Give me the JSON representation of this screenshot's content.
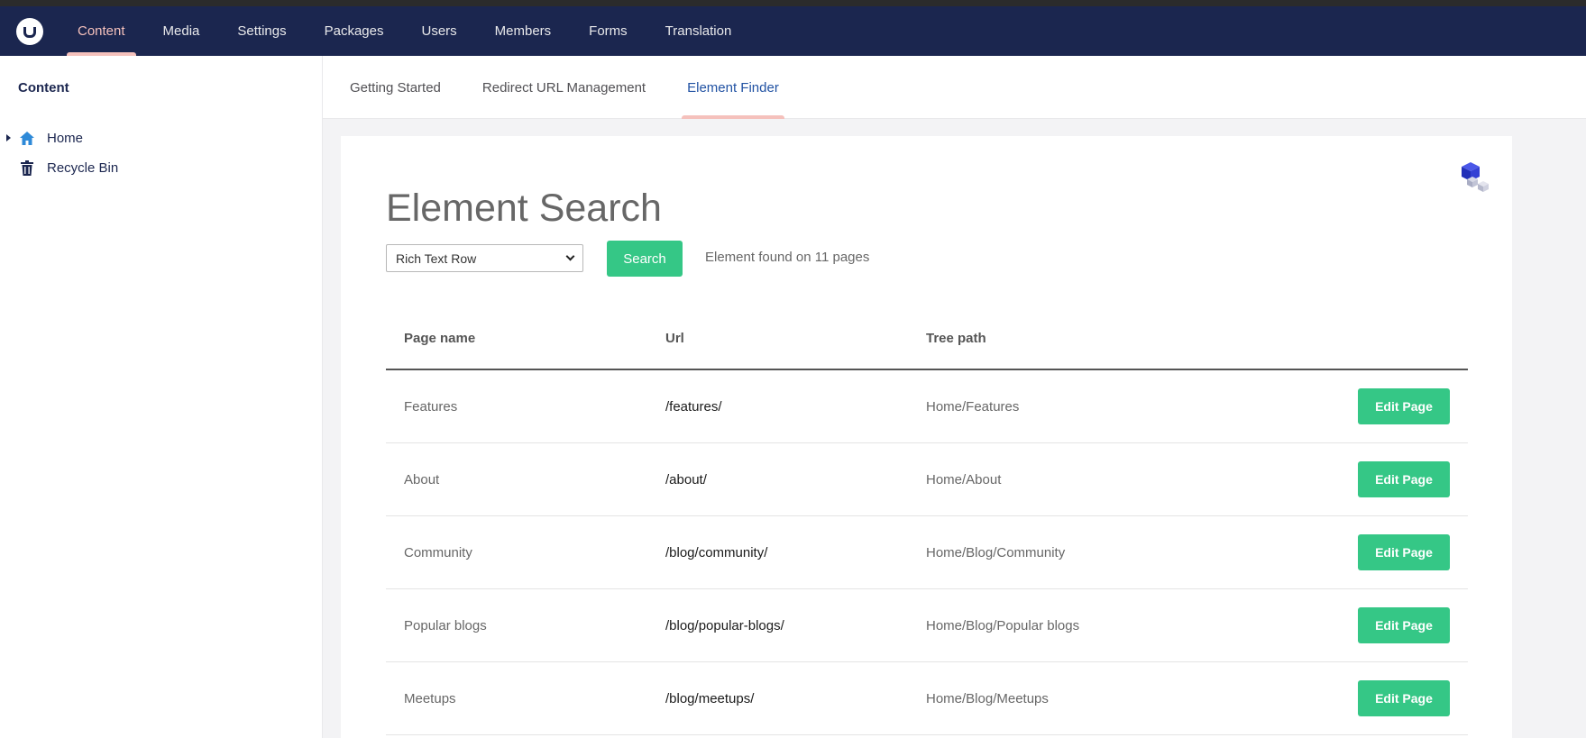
{
  "topnav": {
    "logo": "umbraco-logo-icon",
    "items": [
      {
        "label": "Content",
        "active": true
      },
      {
        "label": "Media",
        "active": false
      },
      {
        "label": "Settings",
        "active": false
      },
      {
        "label": "Packages",
        "active": false
      },
      {
        "label": "Users",
        "active": false
      },
      {
        "label": "Members",
        "active": false
      },
      {
        "label": "Forms",
        "active": false
      },
      {
        "label": "Translation",
        "active": false
      }
    ]
  },
  "sidebar": {
    "title": "Content",
    "items": [
      {
        "label": "Home",
        "icon": "home-icon",
        "expandable": true
      },
      {
        "label": "Recycle Bin",
        "icon": "trash-icon",
        "expandable": false
      }
    ]
  },
  "subtabs": [
    {
      "label": "Getting Started",
      "active": false
    },
    {
      "label": "Redirect URL Management",
      "active": false
    },
    {
      "label": "Element Finder",
      "active": true
    }
  ],
  "panel": {
    "title": "Element Search",
    "select_value": "Rich Text Row",
    "search_label": "Search",
    "found_text": "Element found on 11 pages"
  },
  "table": {
    "headers": [
      "Page name",
      "Url",
      "Tree path",
      ""
    ],
    "action_label": "Edit Page",
    "rows": [
      {
        "name": "Features",
        "url": "/features/",
        "path": "Home/Features"
      },
      {
        "name": "About",
        "url": "/about/",
        "path": "Home/About"
      },
      {
        "name": "Community",
        "url": "/blog/community/",
        "path": "Home/Blog/Community"
      },
      {
        "name": "Popular blogs",
        "url": "/blog/popular-blogs/",
        "path": "Home/Blog/Popular blogs"
      },
      {
        "name": "Meetups",
        "url": "/blog/meetups/",
        "path": "Home/Blog/Meetups"
      }
    ]
  },
  "colors": {
    "topbar": "#1b264f",
    "accent": "#f5c1bc",
    "button": "#35c786",
    "active_tab": "#2152a3"
  }
}
